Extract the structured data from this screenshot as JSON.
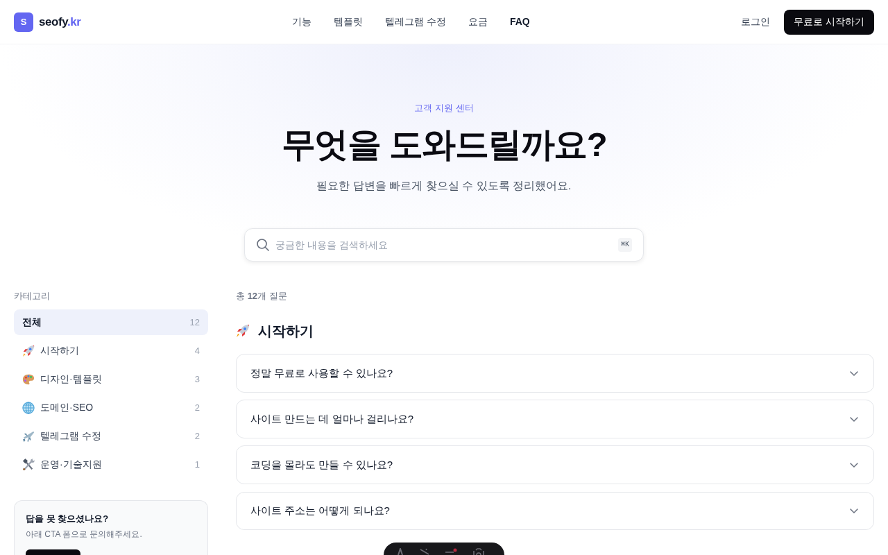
{
  "header": {
    "logo": {
      "mark": "S",
      "name": "seofy",
      "suffix": ".kr"
    },
    "nav": [
      {
        "label": "기능",
        "selected": false
      },
      {
        "label": "템플릿",
        "selected": false
      },
      {
        "label": "텔레그램 수정",
        "selected": false
      },
      {
        "label": "요금",
        "selected": false
      },
      {
        "label": "FAQ",
        "selected": true
      }
    ],
    "login": "로그인",
    "cta": "무료로 시작하기"
  },
  "hero": {
    "eyebrow": "고객 지원 센터",
    "title": "무엇을 도와드릴까요?",
    "subtitle": "필요한 답변을 빠르게 찾으실 수 있도록 정리했어요.",
    "search": {
      "placeholder": "궁금한 내용을 검색하세요",
      "shortcut": "⌘K"
    }
  },
  "sidebar": {
    "heading": "카테고리",
    "categories": [
      {
        "label": "전체",
        "count": "12",
        "selected": true
      },
      {
        "label": "시작하기",
        "count": "4",
        "selected": false
      },
      {
        "label": "디자인·템플릿",
        "count": "3",
        "selected": false
      },
      {
        "label": "도메인·SEO",
        "count": "2",
        "selected": false
      },
      {
        "label": "텔레그램 수정",
        "count": "2",
        "selected": false
      },
      {
        "label": "운영·기술지원",
        "count": "1",
        "selected": false
      }
    ],
    "help_card": {
      "title": "답을 못 찾으셨나요?",
      "text": "아래 CTA 폼으로 문의해주세요."
    }
  },
  "main": {
    "summary": "총 **12**개 질문",
    "sections": [
      {
        "title": "시작하기",
        "questions": [
          {
            "question": "정말 무료로 사용할 수 있나요?",
            "expanded": false
          },
          {
            "question": "사이트 만드는 데 얼마나 걸리나요?",
            "expanded": false
          },
          {
            "question": "코딩을 몰라도 만들 수 있나요?",
            "expanded": false
          },
          {
            "question": "사이트 주소는 어떻게 되나요?",
            "expanded": false
          }
        ]
      }
    ]
  }
}
